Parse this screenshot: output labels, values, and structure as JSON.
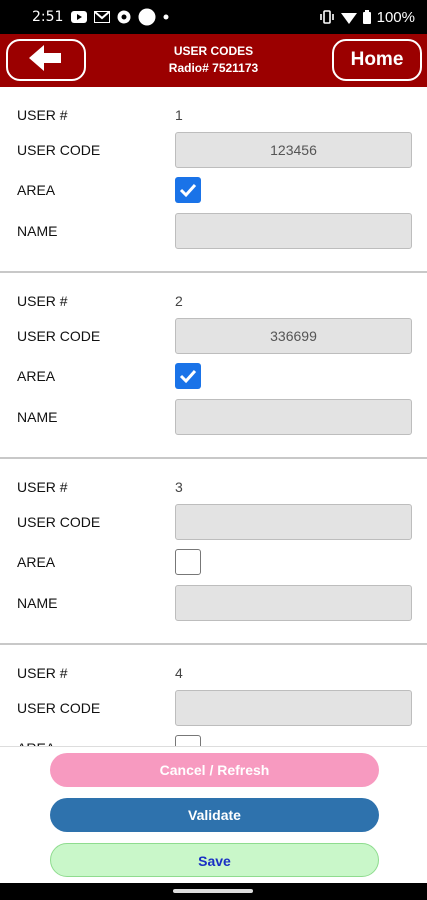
{
  "status_bar": {
    "time": "2:51",
    "battery": "100%",
    "left_icons": [
      "youtube-icon",
      "gmail-icon",
      "radio-icon",
      "circle-icon",
      "dot-icon"
    ],
    "right_icons": [
      "vibrate-icon",
      "wifi-icon",
      "battery-icon"
    ]
  },
  "header": {
    "title_line1": "USER CODES",
    "title_line2": "Radio# 7521173",
    "home_label": "Home",
    "back_icon": "arrow-left-icon",
    "bg_color": "#9b0000"
  },
  "labels": {
    "user_num": "USER #",
    "user_code": "USER CODE",
    "area": "AREA",
    "name": "NAME"
  },
  "users": [
    {
      "number": "1",
      "code": "123456",
      "area_checked": true,
      "name": ""
    },
    {
      "number": "2",
      "code": "336699",
      "area_checked": true,
      "name": ""
    },
    {
      "number": "3",
      "code": "",
      "area_checked": false,
      "name": ""
    },
    {
      "number": "4",
      "code": "",
      "area_checked": false,
      "name": ""
    }
  ],
  "footer": {
    "cancel_label": "Cancel / Refresh",
    "validate_label": "Validate",
    "save_label": "Save"
  }
}
